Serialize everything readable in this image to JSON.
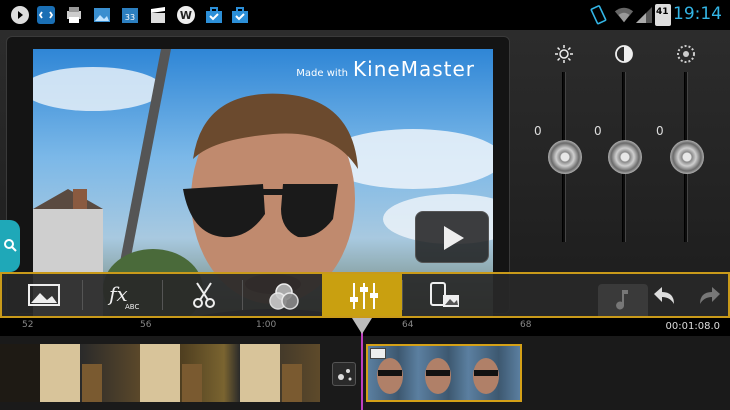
{
  "status_bar": {
    "time": "19:14",
    "battery_level": "41",
    "icons": [
      "media-icon",
      "sync-icon",
      "printer-icon",
      "gallery-icon",
      "calendar-icon",
      "movie-icon",
      "word-icon",
      "briefcase-icon",
      "briefcase-icon",
      "vibrate-icon",
      "wifi-icon",
      "signal-icon",
      "battery-icon"
    ],
    "calendar_number": "33",
    "word_letter": "W"
  },
  "preview": {
    "watermark_prefix": "Made with",
    "watermark_brand": "KineMaster"
  },
  "adjustments": [
    {
      "icon": "brightness-icon",
      "value": "0"
    },
    {
      "icon": "contrast-icon",
      "value": "0"
    },
    {
      "icon": "saturation-icon",
      "value": "0"
    }
  ],
  "toolbar": {
    "tools": [
      "image-icon",
      "fx-icon",
      "scissors-icon",
      "color-filter-icon",
      "adjustments-icon",
      "rotate-media-icon"
    ],
    "fx_label": "fx",
    "fx_sub": "ABC",
    "active_tool": "adjustments-icon",
    "accent": "#c99a1a"
  },
  "timeline": {
    "ruler_labels": [
      "52",
      "56",
      "1:00",
      "64",
      "68"
    ],
    "timecode": "00:01:08.0"
  }
}
